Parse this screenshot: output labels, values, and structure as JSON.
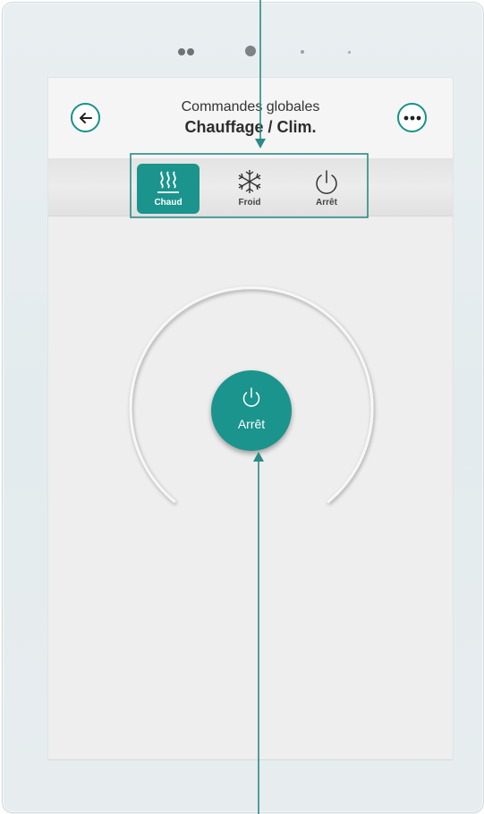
{
  "header": {
    "subtitle": "Commandes globales",
    "title": "Chauffage / Clim."
  },
  "modes": [
    {
      "label": "Chaud",
      "icon": "heat-icon",
      "active": true
    },
    {
      "label": "Froid",
      "icon": "snowflake-icon",
      "active": false
    },
    {
      "label": "Arrêt",
      "icon": "power-icon",
      "active": false
    }
  ],
  "dial": {
    "state_label": "Arrêt",
    "icon": "power-icon"
  },
  "colors": {
    "accent": "#1a948d",
    "screen_bg": "#eeeeee",
    "frame": "#e6ecef"
  }
}
